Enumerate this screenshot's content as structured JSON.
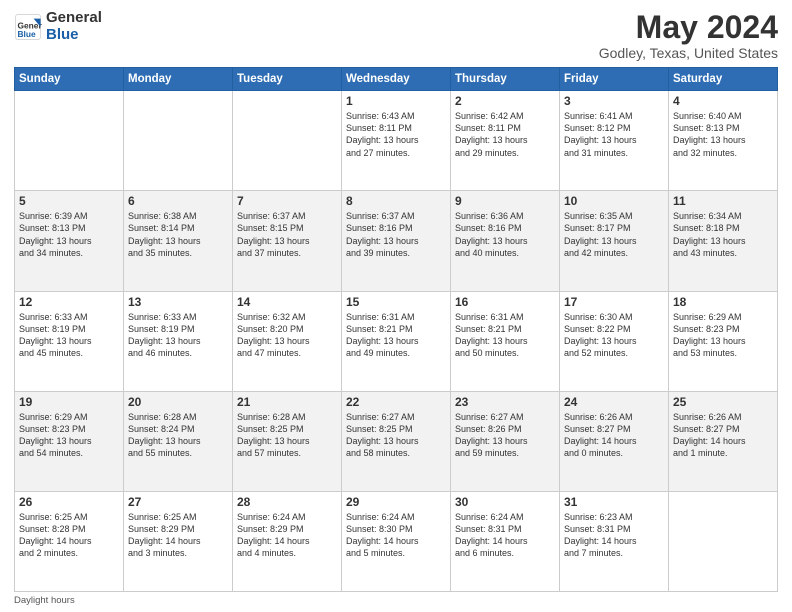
{
  "header": {
    "logo_line1": "General",
    "logo_line2": "Blue",
    "title": "May 2024",
    "subtitle": "Godley, Texas, United States"
  },
  "days_of_week": [
    "Sunday",
    "Monday",
    "Tuesday",
    "Wednesday",
    "Thursday",
    "Friday",
    "Saturday"
  ],
  "weeks": [
    [
      {
        "num": "",
        "info": ""
      },
      {
        "num": "",
        "info": ""
      },
      {
        "num": "",
        "info": ""
      },
      {
        "num": "1",
        "info": "Sunrise: 6:43 AM\nSunset: 8:11 PM\nDaylight: 13 hours\nand 27 minutes."
      },
      {
        "num": "2",
        "info": "Sunrise: 6:42 AM\nSunset: 8:11 PM\nDaylight: 13 hours\nand 29 minutes."
      },
      {
        "num": "3",
        "info": "Sunrise: 6:41 AM\nSunset: 8:12 PM\nDaylight: 13 hours\nand 31 minutes."
      },
      {
        "num": "4",
        "info": "Sunrise: 6:40 AM\nSunset: 8:13 PM\nDaylight: 13 hours\nand 32 minutes."
      }
    ],
    [
      {
        "num": "5",
        "info": "Sunrise: 6:39 AM\nSunset: 8:13 PM\nDaylight: 13 hours\nand 34 minutes."
      },
      {
        "num": "6",
        "info": "Sunrise: 6:38 AM\nSunset: 8:14 PM\nDaylight: 13 hours\nand 35 minutes."
      },
      {
        "num": "7",
        "info": "Sunrise: 6:37 AM\nSunset: 8:15 PM\nDaylight: 13 hours\nand 37 minutes."
      },
      {
        "num": "8",
        "info": "Sunrise: 6:37 AM\nSunset: 8:16 PM\nDaylight: 13 hours\nand 39 minutes."
      },
      {
        "num": "9",
        "info": "Sunrise: 6:36 AM\nSunset: 8:16 PM\nDaylight: 13 hours\nand 40 minutes."
      },
      {
        "num": "10",
        "info": "Sunrise: 6:35 AM\nSunset: 8:17 PM\nDaylight: 13 hours\nand 42 minutes."
      },
      {
        "num": "11",
        "info": "Sunrise: 6:34 AM\nSunset: 8:18 PM\nDaylight: 13 hours\nand 43 minutes."
      }
    ],
    [
      {
        "num": "12",
        "info": "Sunrise: 6:33 AM\nSunset: 8:19 PM\nDaylight: 13 hours\nand 45 minutes."
      },
      {
        "num": "13",
        "info": "Sunrise: 6:33 AM\nSunset: 8:19 PM\nDaylight: 13 hours\nand 46 minutes."
      },
      {
        "num": "14",
        "info": "Sunrise: 6:32 AM\nSunset: 8:20 PM\nDaylight: 13 hours\nand 47 minutes."
      },
      {
        "num": "15",
        "info": "Sunrise: 6:31 AM\nSunset: 8:21 PM\nDaylight: 13 hours\nand 49 minutes."
      },
      {
        "num": "16",
        "info": "Sunrise: 6:31 AM\nSunset: 8:21 PM\nDaylight: 13 hours\nand 50 minutes."
      },
      {
        "num": "17",
        "info": "Sunrise: 6:30 AM\nSunset: 8:22 PM\nDaylight: 13 hours\nand 52 minutes."
      },
      {
        "num": "18",
        "info": "Sunrise: 6:29 AM\nSunset: 8:23 PM\nDaylight: 13 hours\nand 53 minutes."
      }
    ],
    [
      {
        "num": "19",
        "info": "Sunrise: 6:29 AM\nSunset: 8:23 PM\nDaylight: 13 hours\nand 54 minutes."
      },
      {
        "num": "20",
        "info": "Sunrise: 6:28 AM\nSunset: 8:24 PM\nDaylight: 13 hours\nand 55 minutes."
      },
      {
        "num": "21",
        "info": "Sunrise: 6:28 AM\nSunset: 8:25 PM\nDaylight: 13 hours\nand 57 minutes."
      },
      {
        "num": "22",
        "info": "Sunrise: 6:27 AM\nSunset: 8:25 PM\nDaylight: 13 hours\nand 58 minutes."
      },
      {
        "num": "23",
        "info": "Sunrise: 6:27 AM\nSunset: 8:26 PM\nDaylight: 13 hours\nand 59 minutes."
      },
      {
        "num": "24",
        "info": "Sunrise: 6:26 AM\nSunset: 8:27 PM\nDaylight: 14 hours\nand 0 minutes."
      },
      {
        "num": "25",
        "info": "Sunrise: 6:26 AM\nSunset: 8:27 PM\nDaylight: 14 hours\nand 1 minute."
      }
    ],
    [
      {
        "num": "26",
        "info": "Sunrise: 6:25 AM\nSunset: 8:28 PM\nDaylight: 14 hours\nand 2 minutes."
      },
      {
        "num": "27",
        "info": "Sunrise: 6:25 AM\nSunset: 8:29 PM\nDaylight: 14 hours\nand 3 minutes."
      },
      {
        "num": "28",
        "info": "Sunrise: 6:24 AM\nSunset: 8:29 PM\nDaylight: 14 hours\nand 4 minutes."
      },
      {
        "num": "29",
        "info": "Sunrise: 6:24 AM\nSunset: 8:30 PM\nDaylight: 14 hours\nand 5 minutes."
      },
      {
        "num": "30",
        "info": "Sunrise: 6:24 AM\nSunset: 8:31 PM\nDaylight: 14 hours\nand 6 minutes."
      },
      {
        "num": "31",
        "info": "Sunrise: 6:23 AM\nSunset: 8:31 PM\nDaylight: 14 hours\nand 7 minutes."
      },
      {
        "num": "",
        "info": ""
      }
    ]
  ],
  "footer": "Daylight hours"
}
